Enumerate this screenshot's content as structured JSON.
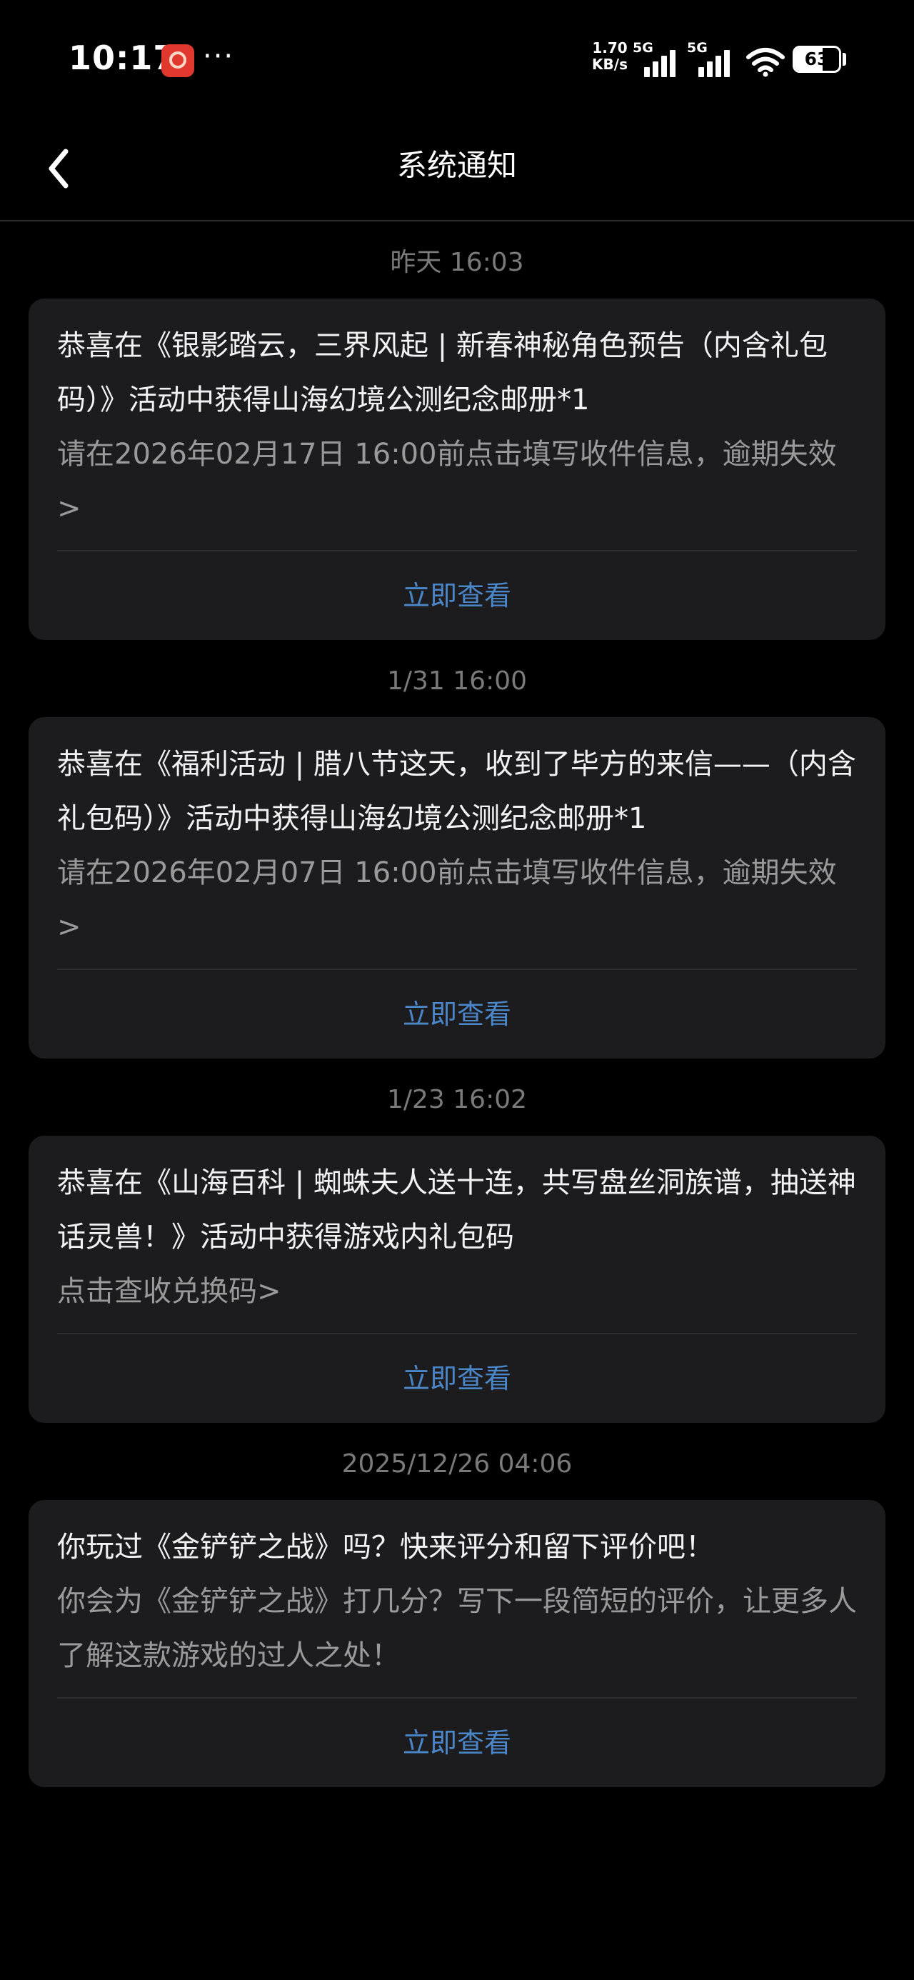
{
  "status_bar": {
    "time": "10:17",
    "more_dots": "···",
    "speed": "1.70 KB/s",
    "net1": "5G",
    "net2": "5G",
    "battery": "63",
    "battery_level": 0.63
  },
  "header": {
    "title": "系统通知",
    "back_icon": "chevron-left-icon"
  },
  "notifications": [
    {
      "time": "昨天  16:03",
      "title": "恭喜在《银影踏云，三界风起 | 新春神秘角色预告（内含礼包码）》活动中获得山海幻境公测纪念邮册*1",
      "desc": "请在2026年02月17日 16:00前点击填写收件信息，逾期失效>",
      "action": "立即查看"
    },
    {
      "time": "1/31  16:00",
      "title": "恭喜在《福利活动 | 腊八节这天，收到了毕方的来信——（内含礼包码）》活动中获得山海幻境公测纪念邮册*1",
      "desc": "请在2026年02月07日 16:00前点击填写收件信息，逾期失效>",
      "action": "立即查看"
    },
    {
      "time": "1/23  16:02",
      "title": "恭喜在《山海百科 | 蜘蛛夫人送十连，共写盘丝洞族谱，抽送神话灵兽！》活动中获得游戏内礼包码",
      "desc": "点击查收兑换码>",
      "action": "立即查看"
    },
    {
      "time": "2025/12/26  04:06",
      "title": "你玩过《金铲铲之战》吗？快来评分和留下评价吧！",
      "desc": "你会为《金铲铲之战》打几分？写下一段简短的评价，让更多人了解这款游戏的过人之处！",
      "action": "立即查看"
    }
  ],
  "colors": {
    "background": "#000000",
    "card": "#1c1c1e",
    "title_text": "#f2f2f2",
    "desc_text": "#9a9a9a",
    "time_text": "#7a7a7a",
    "action_link": "#4a86c8"
  }
}
